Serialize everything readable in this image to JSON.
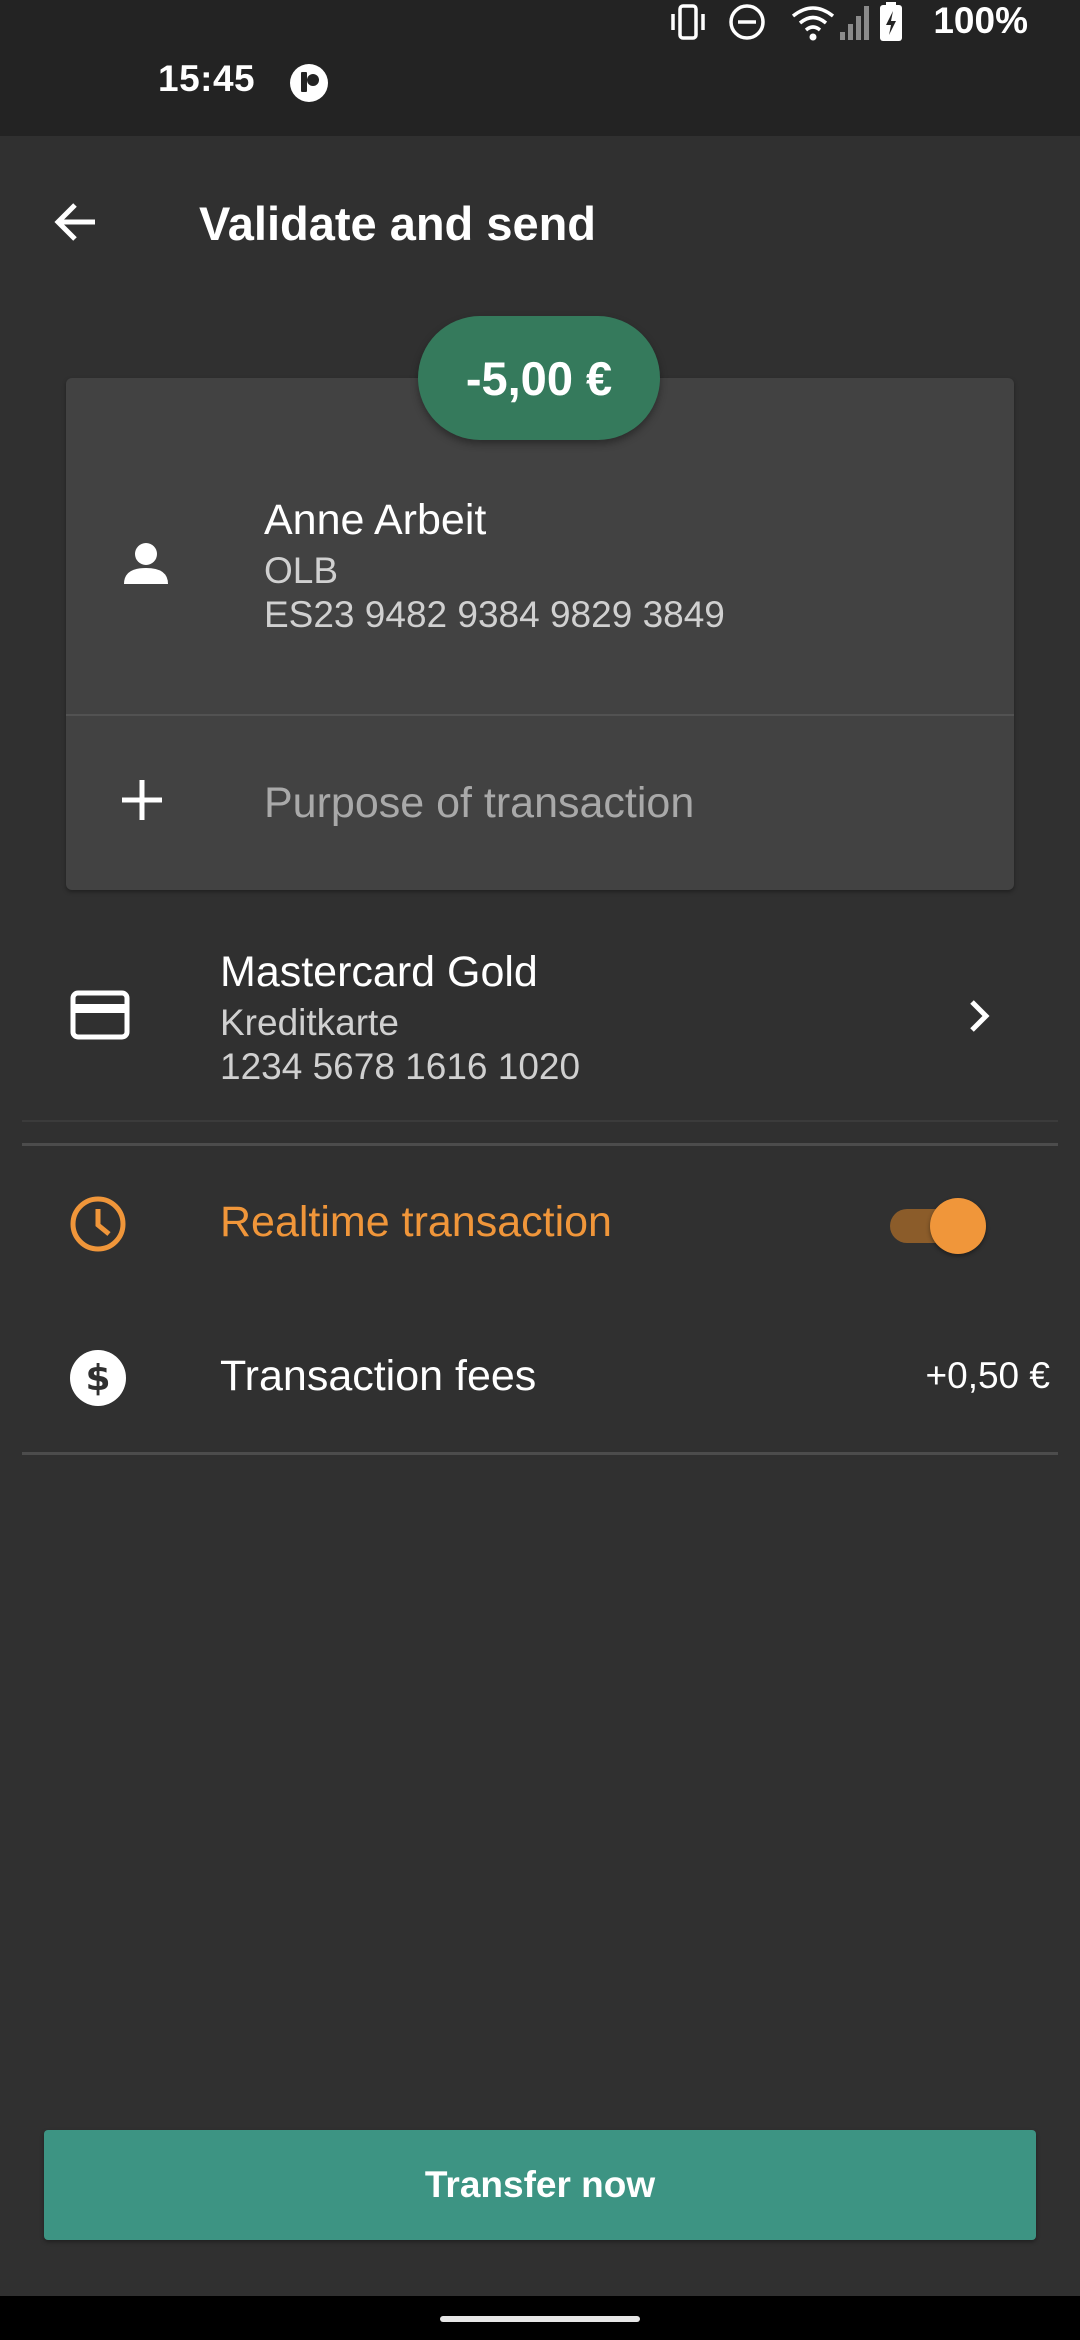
{
  "status_bar": {
    "time": "15:45",
    "battery": "100%",
    "icons": [
      "app-notification-icon",
      "vibrate-icon",
      "do-not-disturb-icon",
      "wifi-icon",
      "cell-signal-icon",
      "battery-charging-icon"
    ]
  },
  "app_bar": {
    "back_icon": "arrow-back-icon",
    "title": "Validate and send"
  },
  "transaction": {
    "amount": "-5,00 €",
    "recipient": {
      "icon": "person-icon",
      "name": "Anne Arbeit",
      "bank": "OLB",
      "iban": "ES23 9482 9384 9829 3849"
    },
    "purpose": {
      "icon": "plus-icon",
      "placeholder": "Purpose of transaction"
    }
  },
  "account": {
    "icon": "credit-card-icon",
    "name": "Mastercard Gold",
    "type": "Kreditkarte",
    "number": "1234 5678 1616 1020",
    "chevron_icon": "chevron-right-icon"
  },
  "options": {
    "realtime": {
      "icon": "clock-icon",
      "label": "Realtime transaction",
      "enabled": true
    },
    "fees": {
      "icon": "dollar-icon",
      "label": "Transaction fees",
      "value": "+0,50 €"
    }
  },
  "footer": {
    "transfer_label": "Transfer now"
  },
  "colors": {
    "background": "#303030",
    "card": "#424242",
    "amount_pill": "#357A5C",
    "accent_orange": "#F0963A",
    "primary_button": "#3D9483"
  }
}
